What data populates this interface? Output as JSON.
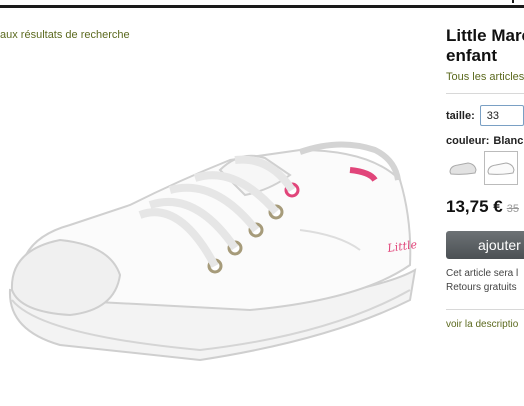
{
  "breadcrumb": {
    "back_label": "aux résultats de recherche"
  },
  "product": {
    "title_line1": "Little Marc",
    "title_line2": "enfant",
    "all_articles_link": "Tous les articles",
    "size_label": "taille:",
    "size_value": "33",
    "color_label": "couleur:",
    "color_value": "Blanc",
    "price": "13,75 €",
    "old_price": "35",
    "add_button_label": "ajouter",
    "info_line1": "Cet article sera l",
    "info_line2": "Retours gratuits",
    "description_link": "voir la descriptio"
  },
  "colors": {
    "accent_link": "#5c6a1f",
    "button": "#55595c",
    "topbar": "#1a1a1a"
  },
  "icons": {
    "swatch_1": "shoe-thumbnail-grey",
    "swatch_2": "shoe-thumbnail-white",
    "product_image": "white-canvas-sneaker"
  }
}
